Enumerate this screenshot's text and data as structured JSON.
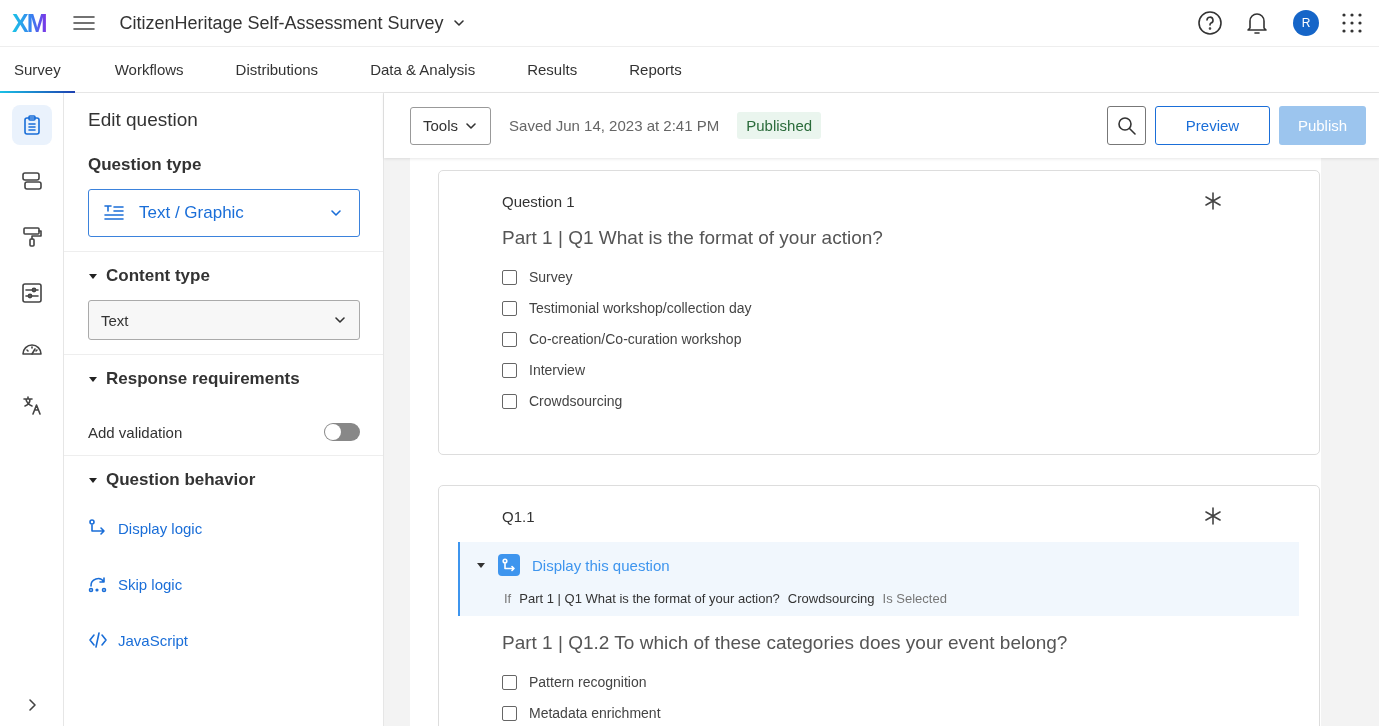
{
  "header": {
    "logo": "XM",
    "title": "CitizenHeritage Self-Assessment Survey",
    "avatar": "R"
  },
  "tabs": [
    {
      "label": "Survey",
      "selected": true
    },
    {
      "label": "Workflows",
      "selected": false
    },
    {
      "label": "Distributions",
      "selected": false
    },
    {
      "label": "Data & Analysis",
      "selected": false
    },
    {
      "label": "Results",
      "selected": false
    },
    {
      "label": "Reports",
      "selected": false
    }
  ],
  "rail": [
    {
      "kind": "clipboard",
      "selected": true
    },
    {
      "kind": "blocks",
      "selected": false
    },
    {
      "kind": "brush",
      "selected": false
    },
    {
      "kind": "sliders",
      "selected": false
    },
    {
      "kind": "gauge",
      "selected": false
    },
    {
      "kind": "translate",
      "selected": false
    }
  ],
  "panel": {
    "title": "Edit question",
    "question_type_label": "Question type",
    "question_type": "Text / Graphic",
    "sections": [
      {
        "title": "Content type",
        "expanded": true,
        "kind": "select",
        "value": "Text"
      },
      {
        "title": "Response requirements",
        "expanded": true,
        "kind": "toggle",
        "label": "Add validation",
        "on": false
      },
      {
        "title": "Question behavior",
        "expanded": true,
        "kind": "links",
        "links": [
          {
            "kind": "display",
            "label": "Display logic"
          },
          {
            "kind": "skip",
            "label": "Skip logic"
          },
          {
            "kind": "code",
            "label": "JavaScript"
          }
        ]
      }
    ]
  },
  "toolbar": {
    "tools": "Tools",
    "saved": "Saved Jun 14, 2023 at 2:41 PM",
    "status": "Published",
    "preview": "Preview",
    "publish": "Publish",
    "publish_disabled": true
  },
  "questions": [
    {
      "label": "Question 1",
      "text": "Part 1 | Q1 What is the format of your action?",
      "choices": [
        {
          "label": "Survey",
          "checked": false
        },
        {
          "label": "Testimonial workshop/collection day",
          "checked": false
        },
        {
          "label": "Co-creation/Co-curation workshop",
          "checked": false
        },
        {
          "label": "Interview",
          "checked": false
        },
        {
          "label": "Crowdsourcing",
          "checked": false
        }
      ]
    },
    {
      "label": "Q1.1",
      "logic": {
        "title": "Display this question",
        "expanded": true,
        "if": "If",
        "question": "Part 1 | Q1 What is the format of your action?",
        "choice": "Crowdsourcing",
        "condition": "Is Selected"
      },
      "text": "Part 1 | Q1.2 To which of these categories does your event belong?",
      "choices": [
        {
          "label": "Pattern recognition",
          "checked": false
        },
        {
          "label": "Metadata enrichment",
          "checked": false
        }
      ]
    }
  ]
}
